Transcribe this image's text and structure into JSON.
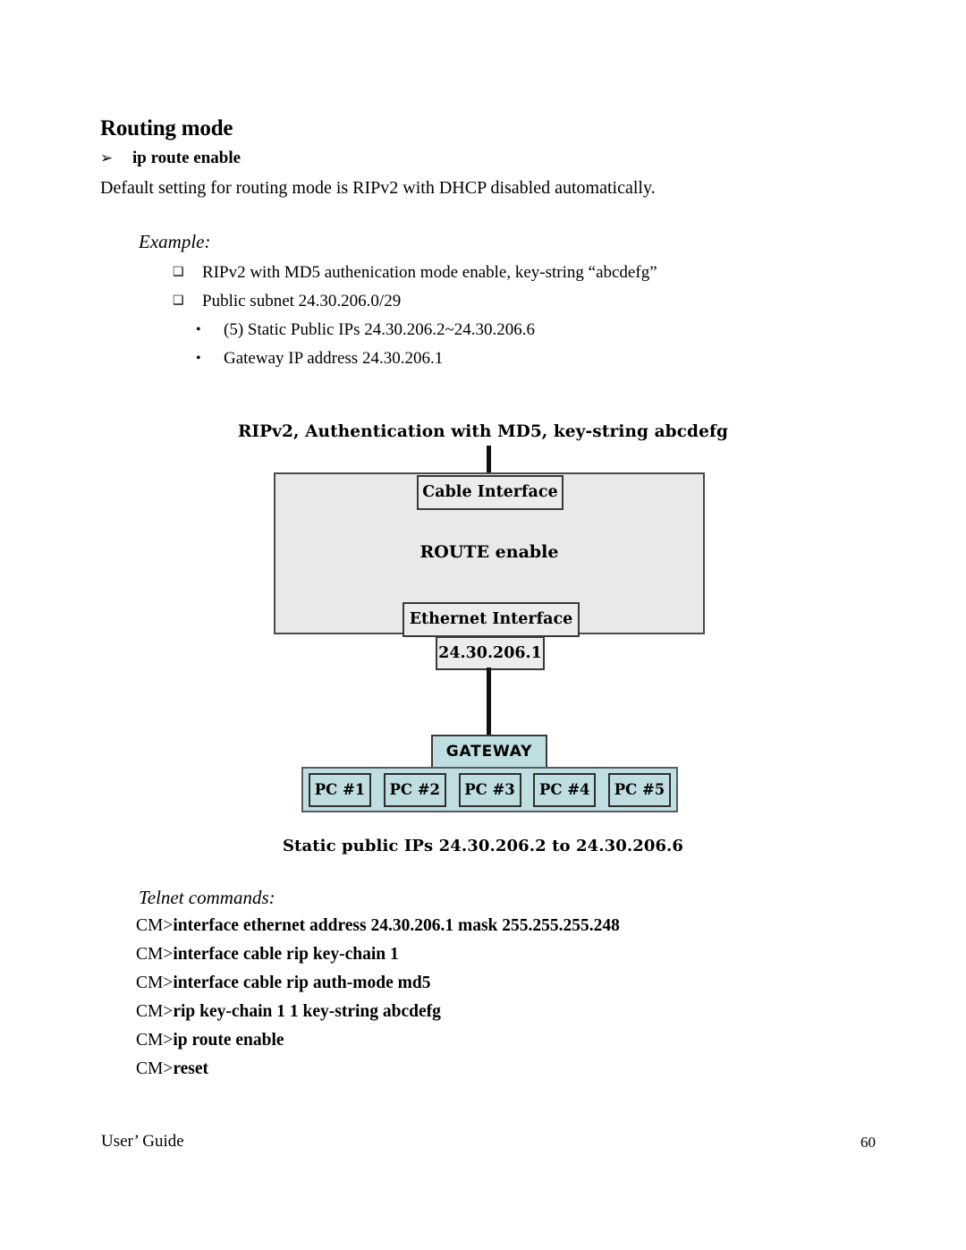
{
  "document": {
    "heading": "Routing mode",
    "arrow_bullet": {
      "glyph": "➢",
      "label": "ip route enable"
    },
    "intro_paragraph": "Default setting for routing mode is RIPv2 with DHCP disabled automatically.",
    "example_label": "Example:",
    "example_bullets": [
      {
        "mark": "❑",
        "text": "RIPv2 with MD5 authenication mode enable, key-string “abcdefg”"
      },
      {
        "mark": "❑",
        "text": "Public subnet 24.30.206.0/29"
      }
    ],
    "example_subbullets": [
      {
        "mark": "•",
        "text": "(5) Static Public IPs 24.30.206.2~24.30.206.6"
      },
      {
        "mark": "•",
        "text": "Gateway IP address 24.30.206.1"
      }
    ]
  },
  "diagram": {
    "title": "RIPv2, Authentication with MD5, key-string abcdefg",
    "caption": "Static public IPs 24.30.206.2 to 24.30.206.6",
    "cable_interface": "Cable Interface",
    "route_enable": "ROUTE enable",
    "ethernet_interface": "Ethernet Interface",
    "ethernet_ip": "24.30.206.1",
    "gateway": "GATEWAY",
    "pcs": [
      "PC #1",
      "PC #2",
      "PC #3",
      "PC #4",
      "PC #5"
    ],
    "colors": {
      "router_fill": "#e9e9e9",
      "interface_fill": "#ececec",
      "lan_fill": "#bfdee2",
      "border": "#3a3a3a",
      "connector": "#111111"
    }
  },
  "telnet": {
    "label": "Telnet commands:",
    "prompt": "CM>",
    "commands": [
      "interface ethernet address 24.30.206.1 mask 255.255.255.248",
      "interface cable rip key-chain 1",
      "interface cable rip auth-mode md5",
      "rip key-chain 1 1 key-string abcdefg",
      "ip route enable",
      "reset"
    ]
  },
  "footer": {
    "left": "User’ Guide",
    "page_number": "60"
  }
}
